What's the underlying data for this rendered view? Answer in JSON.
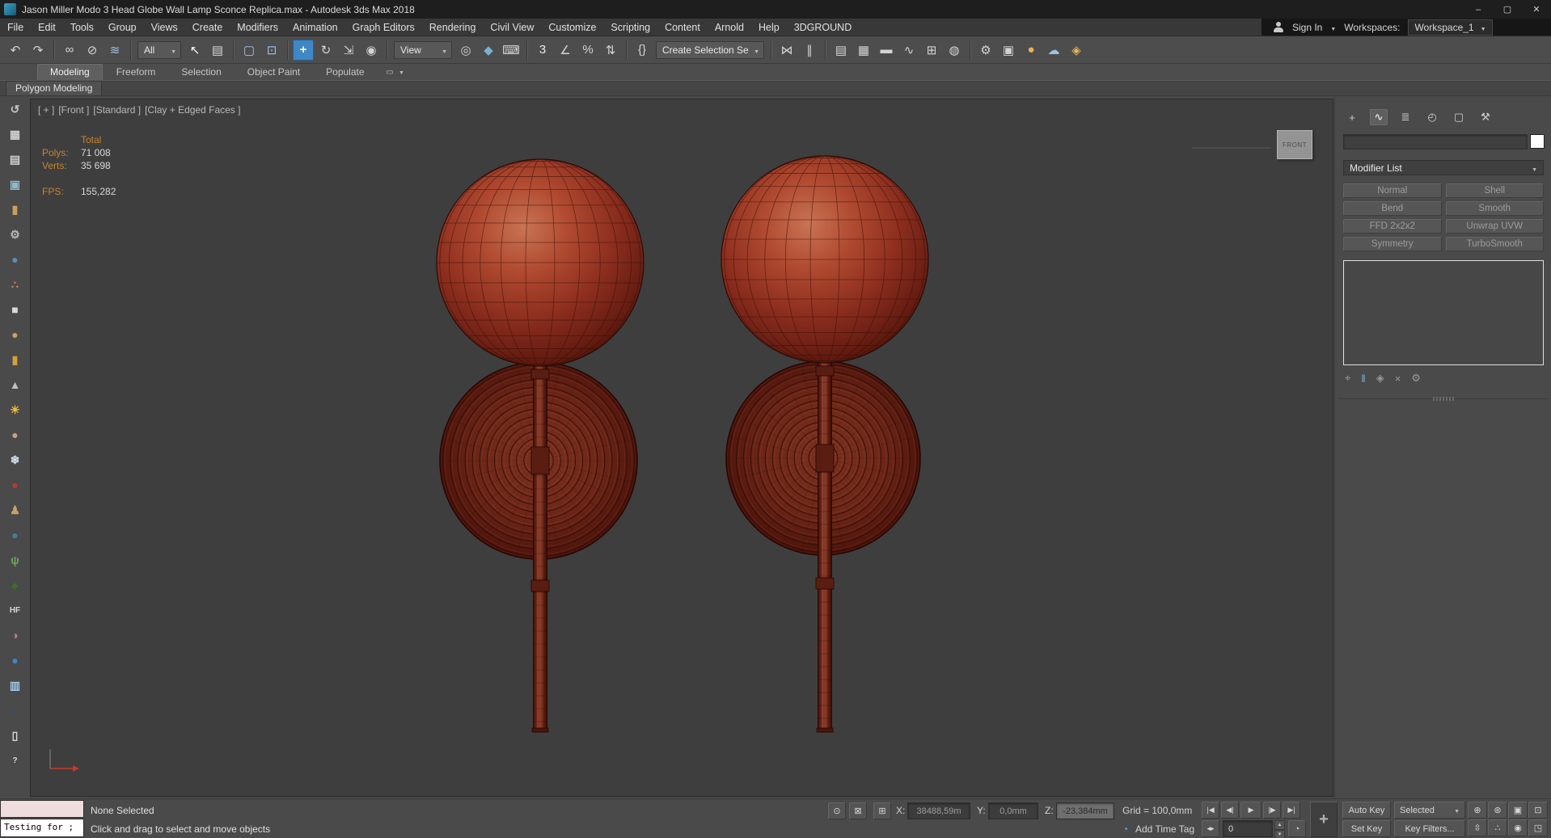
{
  "window": {
    "title": "Jason Miller Modo 3 Head Globe Wall Lamp Sconce Replica.max - Autodesk 3ds Max 2018",
    "minimize": "–",
    "maximize": "▢",
    "close": "✕"
  },
  "menu": {
    "items": [
      "File",
      "Edit",
      "Tools",
      "Group",
      "Views",
      "Create",
      "Modifiers",
      "Animation",
      "Graph Editors",
      "Rendering",
      "Civil View",
      "Customize",
      "Scripting",
      "Content",
      "Arnold",
      "Help",
      "3DGROUND"
    ]
  },
  "account": {
    "sign_in": "Sign In",
    "workspaces_label": "Workspaces:",
    "workspace_value": "Workspace_1"
  },
  "main_toolbar": {
    "items": [
      {
        "name": "undo-icon",
        "glyph": "↶"
      },
      {
        "name": "redo-icon",
        "glyph": "↷"
      },
      {
        "type": "sep"
      },
      {
        "name": "select-and-link-icon",
        "glyph": "∞"
      },
      {
        "name": "unlink-selection-icon",
        "glyph": "⊘"
      },
      {
        "name": "bind-to-space-warp-icon",
        "glyph": "≋",
        "color": "#9dc3e6"
      },
      {
        "type": "sep"
      },
      {
        "type": "dropdown",
        "name": "selection-filter-dropdown",
        "label": "All"
      },
      {
        "name": "select-object-icon",
        "glyph": "↖",
        "color": "#ffffff"
      },
      {
        "name": "select-by-name-icon",
        "glyph": "▤"
      },
      {
        "type": "sep"
      },
      {
        "name": "rectangular-selection-region-icon",
        "glyph": "▢",
        "color": "#9dc3e6"
      },
      {
        "name": "window-crossing-toggle-icon",
        "glyph": "⊡",
        "color": "#9dc3e6"
      },
      {
        "type": "sep"
      },
      {
        "name": "select-and-move-icon",
        "glyph": "+",
        "active": true
      },
      {
        "name": "select-and-rotate-icon",
        "glyph": "↻"
      },
      {
        "name": "select-and-scale-icon",
        "glyph": "⇲"
      },
      {
        "name": "select-and-place-icon",
        "glyph": "◉"
      },
      {
        "type": "sep"
      },
      {
        "type": "dropdown",
        "name": "reference-coordinate-dropdown",
        "label": "View"
      },
      {
        "name": "use-pivot-point-center-icon",
        "glyph": "◎"
      },
      {
        "name": "select-and-manipulate-icon",
        "glyph": "◆",
        "color": "#7ab0d4"
      },
      {
        "name": "keyboard-shortcut-override-icon",
        "glyph": "⌨"
      },
      {
        "type": "sep"
      },
      {
        "name": "snaps-toggle-icon",
        "glyph": "3",
        "color": "#eaeaea"
      },
      {
        "name": "angle-snap-toggle-icon",
        "glyph": "∠"
      },
      {
        "name": "percent-snap-toggle-icon",
        "glyph": "%"
      },
      {
        "name": "spinner-snap-toggle-icon",
        "glyph": "⇅"
      },
      {
        "type": "sep"
      },
      {
        "name": "edit-named-selection-sets-icon",
        "glyph": "{}"
      },
      {
        "type": "dropdown",
        "name": "named-selection-sets-dropdown",
        "label": "Create Selection Se"
      },
      {
        "type": "sep"
      },
      {
        "name": "mirror-icon",
        "glyph": "⋈"
      },
      {
        "name": "align-icon",
        "glyph": "∥"
      },
      {
        "type": "sep"
      },
      {
        "name": "toggle-scene-explorer-icon",
        "glyph": "▤"
      },
      {
        "name": "toggle-layer-explorer-icon",
        "glyph": "▦"
      },
      {
        "name": "toggle-ribbon-icon",
        "glyph": "▬"
      },
      {
        "name": "curve-editor-icon",
        "glyph": "∿"
      },
      {
        "name": "schematic-view-icon",
        "glyph": "⊞"
      },
      {
        "name": "material-editor-icon",
        "glyph": "◍"
      },
      {
        "type": "sep"
      },
      {
        "name": "render-setup-icon",
        "glyph": "⚙"
      },
      {
        "name": "rendered-frame-window-icon",
        "glyph": "▣"
      },
      {
        "name": "render-production-icon",
        "glyph": "●",
        "color": "#e6b35a"
      },
      {
        "name": "render-in-cloud-icon",
        "glyph": "☁",
        "color": "#9dc3e6"
      },
      {
        "name": "autodesk-account-icon",
        "glyph": "◈",
        "color": "#e6b35a"
      }
    ]
  },
  "ribbon": {
    "tabs": [
      {
        "label": "Modeling",
        "active": true
      },
      {
        "label": "Freeform"
      },
      {
        "label": "Selection"
      },
      {
        "label": "Object Paint"
      },
      {
        "label": "Populate"
      }
    ],
    "panel_label": "Polygon Modeling"
  },
  "left_toolbar": {
    "items": [
      {
        "name": "arc-rotate-icon",
        "glyph": "↺",
        "color": "#c5c5c5"
      },
      {
        "name": "grid-panel-icon",
        "glyph": "▦",
        "color": "#cfcfcf"
      },
      {
        "name": "spreadsheet-icon",
        "glyph": "▤",
        "color": "#cfcfcf"
      },
      {
        "name": "image-panel-icon",
        "glyph": "▣",
        "color": "#8fb8c9"
      },
      {
        "name": "gold-cylinder-icon",
        "glyph": "▮",
        "color": "#c9a05a"
      },
      {
        "name": "gear-tool-icon",
        "glyph": "⚙",
        "color": "#b8b8b8"
      },
      {
        "name": "blue-sphere-icon",
        "glyph": "●",
        "color": "#5b8fb9"
      },
      {
        "name": "scatter-dots-icon",
        "glyph": "∴",
        "color": "#d98a5a"
      },
      {
        "name": "white-box-icon",
        "glyph": "■",
        "color": "#d9d9d9"
      },
      {
        "name": "tan-sphere-icon",
        "glyph": "●",
        "color": "#c8a06a"
      },
      {
        "name": "cylinder-icon",
        "glyph": "▮",
        "color": "#d1a03a"
      },
      {
        "name": "cone-icon",
        "glyph": "▲",
        "color": "#bfbfbf"
      },
      {
        "name": "sun-light-icon",
        "glyph": "☀",
        "color": "#f0c030"
      },
      {
        "name": "sphere-icon",
        "glyph": "●",
        "color": "#caa27a"
      },
      {
        "name": "snowflake-icon",
        "glyph": "❄",
        "color": "#d9e6f2"
      },
      {
        "name": "red-ball-icon",
        "glyph": "●",
        "color": "#c0392b"
      },
      {
        "name": "biped-figure-icon",
        "glyph": "♟",
        "color": "#c8a06a"
      },
      {
        "name": "teal-sphere-icon",
        "glyph": "●",
        "color": "#45818e"
      },
      {
        "name": "grass-icon",
        "glyph": "ψ",
        "color": "#6aa84f"
      },
      {
        "name": "foliage-icon",
        "glyph": "♠",
        "color": "#38761d"
      },
      {
        "name": "hf-tool-icon",
        "glyph": "HF",
        "color": "#d9d9d9"
      },
      {
        "name": "palette-icon",
        "glyph": "◑",
        "color": "#c27ba0"
      },
      {
        "name": "blue-ball-icon",
        "glyph": "●",
        "color": "#3d85c6"
      },
      {
        "name": "layers-panel-icon",
        "glyph": "▥",
        "color": "#9fc5e8"
      },
      {
        "name": "dark-box-icon",
        "glyph": "▪",
        "color": "#2f4f6f"
      },
      {
        "name": "document-icon",
        "glyph": "▯",
        "color": "#d9d9d9"
      },
      {
        "name": "help-icon",
        "glyph": "?",
        "color": "#d9d9d9"
      }
    ]
  },
  "viewport": {
    "label_segments": [
      "[ + ]",
      "[Front ]",
      "[Standard ]",
      "[Clay + Edged Faces ]"
    ],
    "stats": {
      "total_label": "Total",
      "polys_label": "Polys:",
      "polys_value": "71 008",
      "verts_label": "Verts:",
      "verts_value": "35 698",
      "fps_label": "FPS:",
      "fps_value": "155,282"
    },
    "viewcube_label": "FRONT"
  },
  "command_panel": {
    "tabs": [
      {
        "name": "tab-create",
        "glyph": "+"
      },
      {
        "name": "tab-modify",
        "glyph": "∿",
        "active": true
      },
      {
        "name": "tab-hierarchy",
        "glyph": "≣"
      },
      {
        "name": "tab-motion",
        "glyph": "◴"
      },
      {
        "name": "tab-display",
        "glyph": "▢"
      },
      {
        "name": "tab-utilities",
        "glyph": "⚒"
      }
    ],
    "modifier_list_label": "Modifier List",
    "modifier_buttons": [
      "Normal",
      "Shell",
      "Bend",
      "Smooth",
      "FFD 2x2x2",
      "Unwrap UVW",
      "Symmetry",
      "TurboSmooth"
    ],
    "stack_tools": [
      {
        "name": "pin-stack-button",
        "glyph": "⌖"
      },
      {
        "name": "show-end-result-button",
        "glyph": "‖",
        "color": "#7ab0d4"
      },
      {
        "name": "make-unique-button",
        "glyph": "◈"
      },
      {
        "name": "remove-modifier-button",
        "glyph": "×"
      },
      {
        "name": "configure-modifier-sets-button",
        "glyph": "⚙"
      }
    ]
  },
  "status_bar": {
    "listener_text": "Testing for ;",
    "selection_status": "None Selected",
    "prompt": "Click and drag to select and move objects",
    "coords": {
      "x_label": "X:",
      "x_value": "38488,59m",
      "y_label": "Y:",
      "y_value": "0,0mm",
      "z_label": "Z:",
      "z_value": "-23,384mm"
    },
    "grid_label": "Grid = 100,0mm",
    "add_time_tag": "Add Time Tag",
    "playback": [
      {
        "name": "go-to-start-button",
        "glyph": "|◀"
      },
      {
        "name": "previous-frame-button",
        "glyph": "◀|"
      },
      {
        "name": "play-animation-button",
        "glyph": "▶"
      },
      {
        "name": "next-frame-button",
        "glyph": "|▶"
      },
      {
        "name": "go-to-end-button",
        "glyph": "▶|"
      }
    ],
    "key_mode_glyph": "◂▸",
    "frame_value": "0",
    "time_config_glyph": "◔",
    "set_keys_glyph": "+",
    "auto_key_label": "Auto Key",
    "set_key_label": "Set Key",
    "selected_set_value": "Selected",
    "key_filters_label": "Key Filters...",
    "nav_buttons": [
      {
        "name": "zoom-button",
        "glyph": "⊕"
      },
      {
        "name": "zoom-all-button",
        "glyph": "⊛"
      },
      {
        "name": "zoom-extents-all-button",
        "glyph": "▣"
      },
      {
        "name": "zoom-region-button",
        "glyph": "⊡"
      },
      {
        "name": "pan-view-button",
        "glyph": "⇳"
      },
      {
        "name": "walk-through-button",
        "glyph": "∴"
      },
      {
        "name": "orbit-button",
        "glyph": "◉"
      },
      {
        "name": "maximize-viewport-toggle-button",
        "glyph": "◳"
      }
    ]
  },
  "colors": {
    "accent_blue": "#3f87c5",
    "globe_red": "#a83b28",
    "viewport_bg": "#3e3e3e"
  }
}
